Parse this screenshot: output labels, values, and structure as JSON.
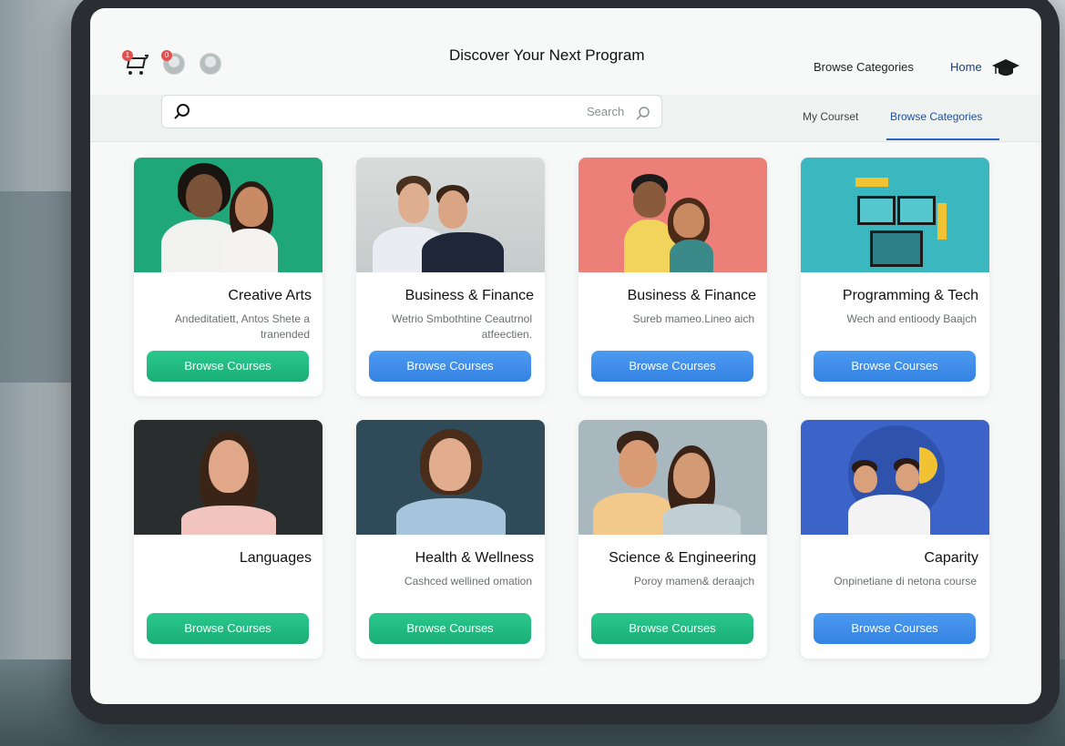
{
  "header": {
    "title": "Discover Your Next Program",
    "nav_home": "Home",
    "nav_browse": "Browse Categories",
    "cart_badge": "1",
    "profile_badge": "0"
  },
  "search": {
    "placeholder": "Search"
  },
  "tabs": [
    {
      "label": "Browse Categories",
      "active": true
    },
    {
      "label": "My Courset",
      "active": false
    }
  ],
  "colors": {
    "accent_blue": "#3482e2",
    "accent_green": "#1aae76",
    "tab_active": "#1d4f9c"
  },
  "cards": [
    {
      "title": "Creative Arts",
      "desc": "Andeditatiett, Antos Shete a tranended",
      "button": "Browse Courses",
      "button_color": "green"
    },
    {
      "title": "Business & Finance",
      "desc": "Wetrio Smbothtine Ceautrnol atfeectien.",
      "button": "Browse Courses",
      "button_color": "blue"
    },
    {
      "title": "Business & Finance",
      "desc": "Sureb mameo.Lineo aich",
      "button": "Browse Courses",
      "button_color": "blue"
    },
    {
      "title": "Programming & Tech",
      "desc": "Wech and entioody Baajch",
      "button": "Browse Courses",
      "button_color": "blue"
    },
    {
      "title": "Languages",
      "desc": "",
      "button": "Browse Courses",
      "button_color": "green"
    },
    {
      "title": "Health & Wellness",
      "desc": "Cashced wellined omation",
      "button": "Browse Courses",
      "button_color": "green"
    },
    {
      "title": "Science & Engineering",
      "desc": "Poroy mamen& deraajch",
      "button": "Browse Courses",
      "button_color": "green"
    },
    {
      "title": "Caparity",
      "desc": "Onpinetiane di netona course",
      "button": "Browse Courses",
      "button_color": "blue"
    }
  ]
}
